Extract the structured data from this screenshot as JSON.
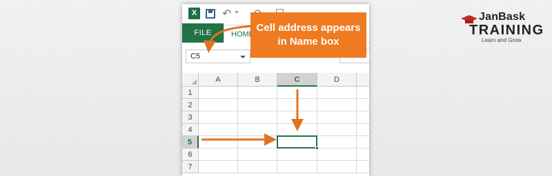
{
  "qat": {
    "app_logo_letter": "X",
    "icons": [
      "excel-logo-icon",
      "save-icon",
      "undo-icon",
      "undo-dropdown-icon",
      "redo-icon",
      "document-icon"
    ]
  },
  "ribbon": {
    "tabs": [
      {
        "label": "FILE",
        "active": false
      },
      {
        "label": "HOME",
        "active": true
      }
    ]
  },
  "namebox": {
    "value": "C5"
  },
  "columns": [
    "A",
    "B",
    "C",
    "D"
  ],
  "rows": [
    "1",
    "2",
    "3",
    "4",
    "5",
    "6",
    "7"
  ],
  "active_cell": {
    "column": "C",
    "row": "5"
  },
  "callout": {
    "line1": "Cell address appears",
    "line2": "in Name box"
  },
  "brand": {
    "name_part1": "JanBask",
    "name_part2": "TRAINING",
    "tagline": "Learn and Grow"
  },
  "colors": {
    "excel_green": "#217346",
    "callout_orange": "#ef7a21",
    "arrow_orange": "#e2731e",
    "brand_red": "#c62828"
  }
}
